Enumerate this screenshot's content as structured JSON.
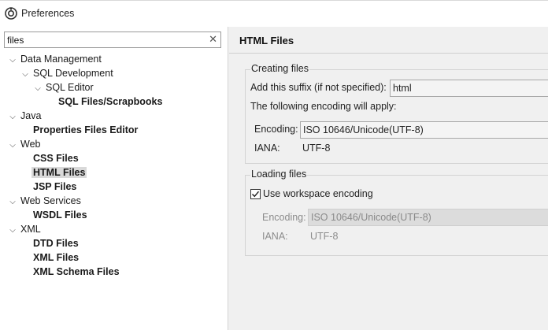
{
  "window": {
    "title": "Preferences",
    "icon": "eclipse-icon"
  },
  "filter": {
    "value": "files",
    "clear_icon": "clear-icon"
  },
  "tree": [
    {
      "label": "Data Management",
      "expanded": true
    },
    {
      "label": "SQL Development",
      "expanded": true
    },
    {
      "label": "SQL Editor",
      "expanded": true
    },
    {
      "label": "SQL Files/Scrapbooks"
    },
    {
      "label": "Java",
      "expanded": true
    },
    {
      "label": "Properties Files Editor"
    },
    {
      "label": "Web",
      "expanded": true
    },
    {
      "label": "CSS Files"
    },
    {
      "label": "HTML Files",
      "selected": true
    },
    {
      "label": "JSP Files"
    },
    {
      "label": "Web Services",
      "expanded": true
    },
    {
      "label": "WSDL Files"
    },
    {
      "label": "XML",
      "expanded": true
    },
    {
      "label": "DTD Files"
    },
    {
      "label": "XML Files"
    },
    {
      "label": "XML Schema Files"
    }
  ],
  "page": {
    "title": "HTML Files",
    "creating": {
      "group_title": "Creating files",
      "suffix_label": "Add this suffix (if not specified):",
      "suffix_value": "html",
      "encoding_note": "The following encoding will apply:",
      "encoding_label": "Encoding:",
      "encoding_value": "ISO 10646/Unicode(UTF-8)",
      "iana_label": "IANA:",
      "iana_value": "UTF-8"
    },
    "loading": {
      "group_title": "Loading files",
      "workspace_label": "Use workspace encoding",
      "workspace_checked": true,
      "encoding_label": "Encoding:",
      "encoding_value": "ISO 10646/Unicode(UTF-8)",
      "iana_label": "IANA:",
      "iana_value": "UTF-8"
    }
  }
}
